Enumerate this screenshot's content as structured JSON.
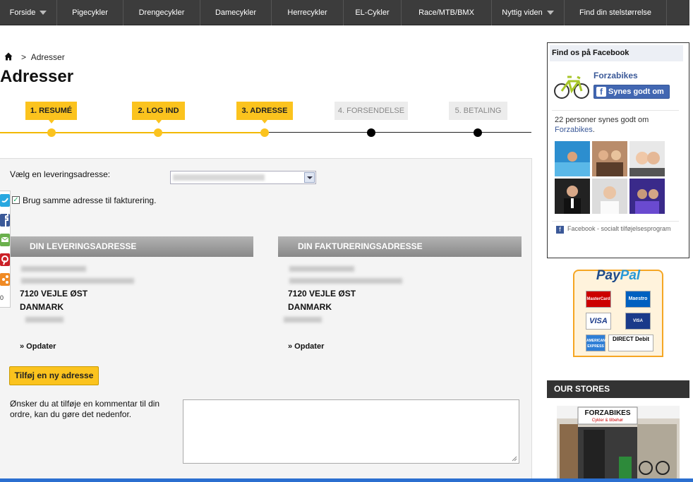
{
  "nav": {
    "items": [
      {
        "label": "Forside",
        "dropdown": true
      },
      {
        "label": "Pigecykler",
        "dropdown": false
      },
      {
        "label": "Drengecykler",
        "dropdown": false
      },
      {
        "label": "Damecykler",
        "dropdown": false
      },
      {
        "label": "Herrecykler",
        "dropdown": false
      },
      {
        "label": "EL-Cykler",
        "dropdown": false
      },
      {
        "label": "Race/MTB/BMX",
        "dropdown": false
      },
      {
        "label": "Nyttig viden",
        "dropdown": true
      },
      {
        "label": "Find din stelstørrelse",
        "dropdown": false
      }
    ]
  },
  "breadcrumb": {
    "separator": ">",
    "current": "Adresser"
  },
  "page_title": "Adresser",
  "steps": [
    {
      "label": "1. RESUMÉ",
      "state": "done"
    },
    {
      "label": "2. LOG IND",
      "state": "done"
    },
    {
      "label": "3. ADRESSE",
      "state": "done"
    },
    {
      "label": "4. FORSENDELSE",
      "state": "todo"
    },
    {
      "label": "5. BETALING",
      "state": "todo"
    }
  ],
  "form": {
    "delivery_select_label": "Vælg en leveringsadresse:",
    "same_address_label": "Brug samme adresse til fakturering.",
    "same_address_checked": true,
    "delivery": {
      "heading": "DIN LEVERINGSADRESSE",
      "city": "7120 VEJLE ØST",
      "country": "DANMARK",
      "update": "» Opdater"
    },
    "billing": {
      "heading": "DIN FAKTURERINGSADRESSE",
      "city": "7120 VEJLE ØST",
      "country": "DANMARK",
      "update": "» Opdater"
    },
    "add_button": "Tilføj en ny adresse",
    "comment_label": "Ønsker du at tilføje en kommentar til din ordre, kan du gøre det nedenfor."
  },
  "share": {
    "count": "0",
    "icons": [
      "twitter-icon",
      "facebook-icon",
      "email-icon",
      "pinterest-icon",
      "more-share-icon"
    ]
  },
  "facebook": {
    "heading": "Find os på Facebook",
    "page_name": "Forzabikes",
    "like_label": "Synes godt om",
    "count_text": "22 personer synes godt om",
    "count_link": "Forzabikes",
    "count_end": ".",
    "plugin_label": "Facebook - socialt tilføjelsesprogram"
  },
  "paypal": {
    "logo_a": "Pay",
    "logo_b": "Pal",
    "cards": [
      "MasterCard",
      "Maestro",
      "VISA",
      "VISA ELECTRON",
      "AMERICAN EXPRESS",
      "DIRECT Debit"
    ]
  },
  "stores": {
    "heading": "OUR STORES",
    "sign": "FORZABIKES",
    "sign_sub": "Cykler & tilbehør"
  },
  "colors": {
    "accent": "#fbc31e",
    "nav": "#3c3c3c",
    "facebook": "#4267b2",
    "paypal_border": "#f5a623"
  }
}
